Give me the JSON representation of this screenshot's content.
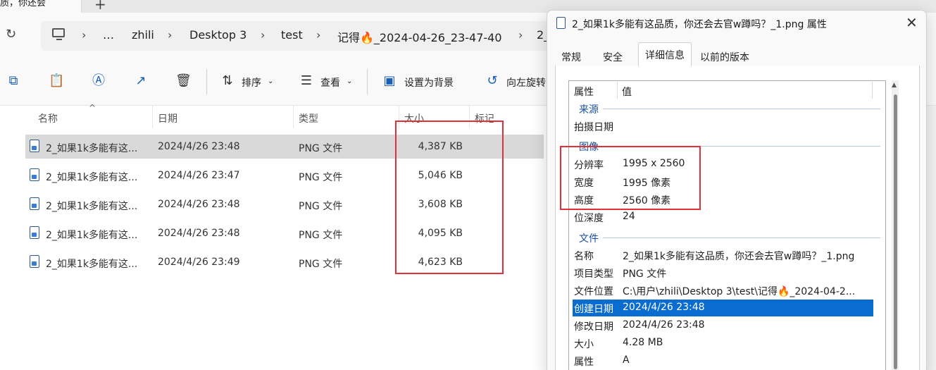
{
  "explorer": {
    "tab_title": "质，你还会",
    "tab_new": "+",
    "refresh_icon": "refresh-icon",
    "breadcrumb": [
      "…",
      "zhili",
      "Desktop 3",
      "test",
      "记得🔥_2024-04-26_23-47-40",
      "2_"
    ],
    "toolbar": {
      "sort_label": "排序",
      "view_label": "查看",
      "set_background_label": "设置为背景",
      "rotate_left_label": "向左旋转"
    },
    "columns": {
      "name": "名称",
      "date": "日期",
      "type": "类型",
      "size": "大小",
      "tags": "标记"
    },
    "files": [
      {
        "name": "2_如果1k多能有这...",
        "date": "2024/4/26 23:48",
        "type": "PNG 文件",
        "size": "4,387 KB",
        "selected": true
      },
      {
        "name": "2_如果1k多能有这...",
        "date": "2024/4/26 23:47",
        "type": "PNG 文件",
        "size": "5,046 KB",
        "selected": false
      },
      {
        "name": "2_如果1k多能有这...",
        "date": "2024/4/26 23:48",
        "type": "PNG 文件",
        "size": "3,608 KB",
        "selected": false
      },
      {
        "name": "2_如果1k多能有这...",
        "date": "2024/4/26 23:48",
        "type": "PNG 文件",
        "size": "4,095 KB",
        "selected": false
      },
      {
        "name": "2_如果1k多能有这...",
        "date": "2024/4/26 23:49",
        "type": "PNG 文件",
        "size": "4,623 KB",
        "selected": false
      }
    ]
  },
  "dialog": {
    "title": "2_如果1k多能有这品质，你还会去官w蹲吗？_1.png 属性",
    "tabs": [
      "常规",
      "安全",
      "详细信息",
      "以前的版本"
    ],
    "active_tab": "详细信息",
    "header": {
      "property": "属性",
      "value": "值"
    },
    "groups": {
      "source": "来源",
      "image": "图像",
      "file": "文件"
    },
    "rows": {
      "date_taken": {
        "key": "拍摄日期",
        "value": ""
      },
      "dimensions": {
        "key": "分辨率",
        "value": "1995 x 2560"
      },
      "width": {
        "key": "宽度",
        "value": "1995 像素"
      },
      "height": {
        "key": "高度",
        "value": "2560 像素"
      },
      "bit_depth": {
        "key": "位深度",
        "value": "24"
      },
      "name": {
        "key": "名称",
        "value": "2_如果1k多能有这品质，你还会去官w蹲吗？_1.png"
      },
      "item_type": {
        "key": "项目类型",
        "value": "PNG 文件"
      },
      "folder_path": {
        "key": "文件位置",
        "value": "C:\\用户\\zhili\\Desktop 3\\test\\记得🔥_2024-04-2..."
      },
      "date_created": {
        "key": "创建日期",
        "value": "2024/4/26 23:48"
      },
      "date_modified": {
        "key": "修改日期",
        "value": "2024/4/26 23:48"
      },
      "size": {
        "key": "大小",
        "value": "4.28 MB"
      },
      "attributes": {
        "key": "属性",
        "value": "A"
      }
    },
    "selected_row": "date_created"
  },
  "annotation_color": "#e0303a",
  "selection_color": "#0a6ccf"
}
